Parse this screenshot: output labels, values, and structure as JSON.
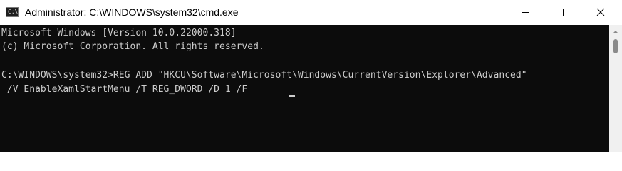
{
  "window": {
    "title": "Administrator: C:\\WINDOWS\\system32\\cmd.exe",
    "icon": "cmd-icon",
    "icon_glyph": "C:\\"
  },
  "controls": {
    "minimize": "minimize-icon",
    "maximize": "maximize-icon",
    "close": "close-icon"
  },
  "console": {
    "lines": [
      "Microsoft Windows [Version 10.0.22000.318]",
      "(c) Microsoft Corporation. All rights reserved.",
      "C:\\WINDOWS\\system32>REG ADD \"HKCU\\Software\\Microsoft\\Windows\\CurrentVersion\\Explorer\\Advanced\"",
      " /V EnableXamlStartMenu /T REG_DWORD /D 1 /F"
    ],
    "foreground": "#cccccc",
    "background": "#0c0c0c"
  },
  "scrollbar": {
    "up_arrow": "scroll-up-arrow-icon"
  }
}
